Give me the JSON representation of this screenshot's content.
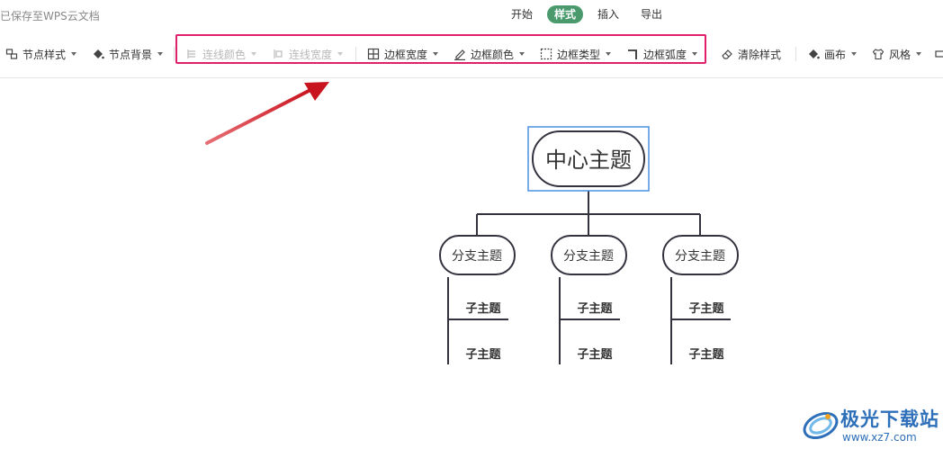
{
  "topbar": {
    "save_status": "已保存至WPS云文档",
    "tabs": [
      {
        "label": "开始"
      },
      {
        "label": "样式"
      },
      {
        "label": "插入"
      },
      {
        "label": "导出"
      }
    ],
    "active_tab": "样式"
  },
  "toolbar": {
    "node_style": "节点样式",
    "node_background": "节点背景",
    "line_color": "连线颜色",
    "line_width": "连线宽度",
    "border_width": "边框宽度",
    "border_color": "边框颜色",
    "border_type": "边框类型",
    "border_radius": "边框弧度",
    "clear_style": "清除样式",
    "canvas": "画布",
    "style": "风格"
  },
  "mindmap": {
    "center": "中心主题",
    "branches": [
      {
        "label": "分支主题",
        "children": [
          "子主题",
          "子主题"
        ]
      },
      {
        "label": "分支主题",
        "children": [
          "子主题",
          "子主题"
        ]
      },
      {
        "label": "分支主题",
        "children": [
          "子主题",
          "子主题"
        ]
      }
    ]
  },
  "annotation": {
    "highlight_color": "#e0206a",
    "arrow_color": "#d9202a"
  },
  "watermark": {
    "title": "极光下载站",
    "url": "www.xz7.com"
  },
  "colors": {
    "active_tab": "#4a9a6e",
    "selection": "#4a90e2",
    "node_border": "#333340"
  }
}
